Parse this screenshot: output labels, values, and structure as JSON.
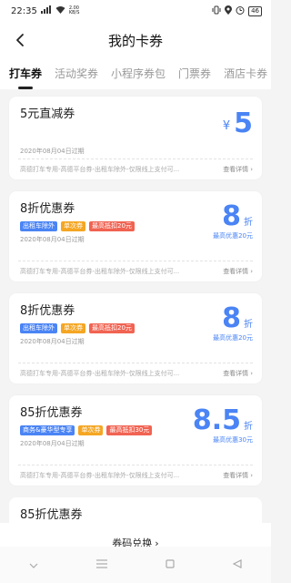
{
  "status": {
    "time": "22:35",
    "net_speed_top": "2.00",
    "net_speed_unit": "KB/S",
    "battery": "46"
  },
  "nav": {
    "title": "我的卡券"
  },
  "tabs": [
    {
      "label": "打车券",
      "active": true
    },
    {
      "label": "活动奖券",
      "active": false
    },
    {
      "label": "小程序券包",
      "active": false
    },
    {
      "label": "门票券",
      "active": false
    },
    {
      "label": "酒店卡券",
      "active": false
    }
  ],
  "coupons": [
    {
      "title": "5元直减券",
      "tags": [],
      "expire": "2020年08月04日过期",
      "currency": "¥",
      "amount": "5",
      "unit": "",
      "max_note": "",
      "desc": "高德打车专用-高德平台券-出租车除外-仅限线上支付可...",
      "detail": "查看详情"
    },
    {
      "title": "8折优惠券",
      "tags": [
        {
          "text": "出租车除外",
          "color": "blue"
        },
        {
          "text": "单次券",
          "color": "orange"
        },
        {
          "text": "最高抵扣20元",
          "color": "red"
        }
      ],
      "expire": "2020年08月04日过期",
      "currency": "",
      "amount": "8",
      "unit": "折",
      "max_note": "最高优惠20元",
      "desc": "高德打车专用-高德平台券-出租车除外-仅限线上支付可...",
      "detail": "查看详情"
    },
    {
      "title": "8折优惠券",
      "tags": [
        {
          "text": "出租车除外",
          "color": "blue"
        },
        {
          "text": "单次券",
          "color": "orange"
        },
        {
          "text": "最高抵扣20元",
          "color": "red"
        }
      ],
      "expire": "2020年08月04日过期",
      "currency": "",
      "amount": "8",
      "unit": "折",
      "max_note": "最高优惠20元",
      "desc": "高德打车专用-高德平台券-出租车除外-仅限线上支付可...",
      "detail": "查看详情"
    },
    {
      "title": "85折优惠券",
      "tags": [
        {
          "text": "商务&豪华型专享",
          "color": "blue"
        },
        {
          "text": "单次券",
          "color": "orange"
        },
        {
          "text": "最高抵扣30元",
          "color": "red"
        }
      ],
      "expire": "2020年08月04日过期",
      "currency": "",
      "amount": "8.5",
      "unit": "折",
      "max_note": "最高优惠30元",
      "desc": "高德打车专用-高德平台券-出租车除外-仅限线上支付可...",
      "detail": "查看详情"
    }
  ],
  "partial_coupon": {
    "title": "85折优惠券"
  },
  "footer": {
    "label": "券码兑换"
  },
  "colors": {
    "accent": "#4a84f5",
    "tag_blue": "#4a84f5",
    "tag_orange": "#f5a623",
    "tag_red": "#f16352"
  }
}
